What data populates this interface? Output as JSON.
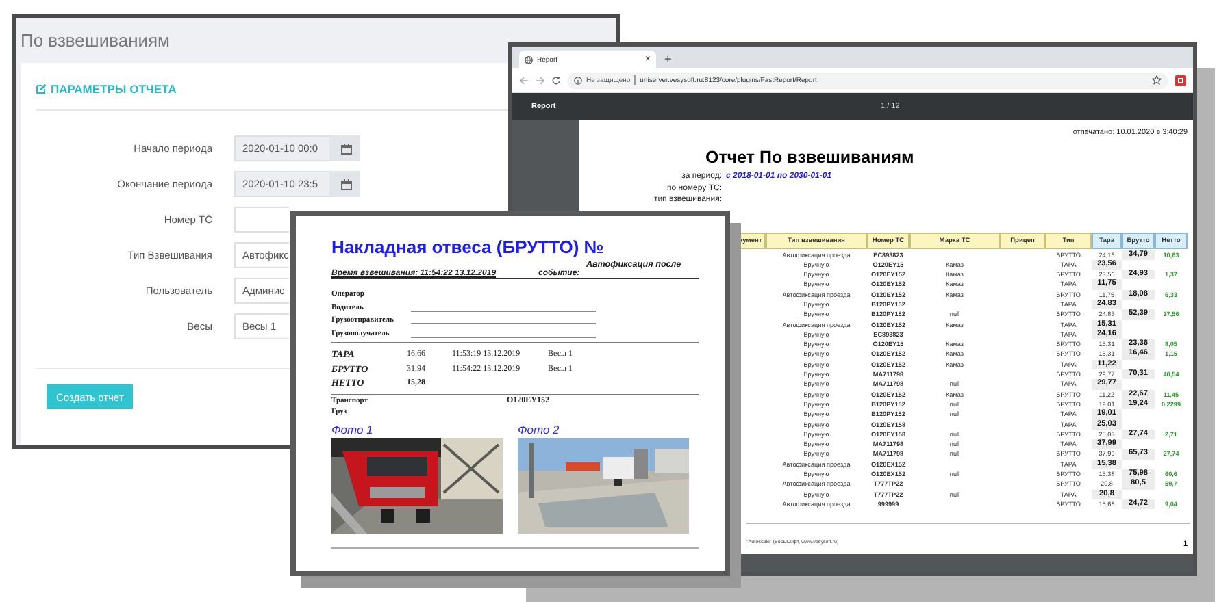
{
  "form_window": {
    "title": "По взвешиваниям",
    "section_title": "ПАРАМЕТРЫ ОТЧЕТА",
    "fields": [
      {
        "label": "Начало периода",
        "kind": "date",
        "value": "2020-01-10 00:0"
      },
      {
        "label": "Окончание периода",
        "kind": "date",
        "value": "2020-01-10 23:5"
      },
      {
        "label": "Номер ТС",
        "kind": "text"
      },
      {
        "label": "Тип Взвешивания",
        "kind": "select",
        "value": "Автофикс"
      },
      {
        "label": "Пользователь",
        "kind": "select",
        "value": "Админис"
      },
      {
        "label": "Весы",
        "kind": "select",
        "value": "Весы 1"
      }
    ],
    "submit_button": "Создать отчет"
  },
  "report_window": {
    "tab_title": "Report",
    "tab_close": "×",
    "new_tab": "+",
    "security_label": "Не защищено",
    "url": "uniserver.vesysoft.ru:8123/core/plugins/FastReport/Report",
    "viewer_title": "Report",
    "page_counter": "1 / 12",
    "report": {
      "title": "Отчет По взвешиваниям",
      "printed": "отпечатано: 10.01.2020 в 3:40:29",
      "meta": [
        {
          "label": "за период:",
          "value": "с 2018-01-01 по 2030-01-01"
        },
        {
          "label": "по номеру ТС:"
        },
        {
          "label": "тип взвешивания:"
        }
      ],
      "columns": [
        "кумент",
        "Тип взвешивания",
        "Номер ТС",
        "Марка ТС",
        "Прицеп",
        "Тип",
        "Тара",
        "Брутто",
        "Нетто"
      ],
      "rows": [
        {
          "weighing_type": "Автофиксация проезда",
          "plate": "EC893823",
          "type": "БРУТТО",
          "tara": "24,16",
          "brutto": "34,79",
          "netto": "10,63"
        },
        {
          "weighing_type": "Вручную",
          "plate": "O120EY15",
          "brand": "Камаз",
          "type": "ТАРА",
          "tara": "23,56"
        },
        {
          "weighing_type": "Вручную",
          "plate": "O120EY152",
          "brand": "Камаз",
          "type": "БРУТТО",
          "tara": "23,56",
          "brutto": "24,93",
          "netto": "1,37"
        },
        {
          "weighing_type": "Вручную",
          "plate": "O120EY152",
          "brand": "Камаз",
          "type": "ТАРА",
          "tara": "11,75"
        },
        {
          "weighing_type": "Автофиксация проезда",
          "plate": "O120EY152",
          "brand": "Камаз",
          "type": "БРУТТО",
          "tara": "11,75",
          "brutto": "18,08",
          "netto": "6,33"
        },
        {
          "weighing_type": "Вручную",
          "plate": "B120PY152",
          "type": "ТАРА",
          "tara": "24,83"
        },
        {
          "weighing_type": "Вручную",
          "plate": "B120PY152",
          "brand": "null",
          "type": "БРУТТО",
          "tara": "24,83",
          "brutto": "52,39",
          "netto": "27,56"
        },
        {
          "weighing_type": "Автофиксация проезда",
          "plate": "O120EY152",
          "brand": "Камаз",
          "type": "ТАРА",
          "tara": "15,31"
        },
        {
          "weighing_type": "Вручную",
          "plate": "EC893823",
          "type": "ТАРА",
          "tara": "24,16"
        },
        {
          "weighing_type": "Вручную",
          "plate": "O120EY15",
          "brand": "Камаз",
          "type": "БРУТТО",
          "tara": "15,31",
          "brutto": "23,36",
          "netto": "8,05"
        },
        {
          "weighing_type": "Вручную",
          "plate": "O120EY152",
          "brand": "Камаз",
          "type": "БРУТТО",
          "tara": "15,31",
          "brutto": "16,46",
          "netto": "1,15"
        },
        {
          "weighing_type": "Вручную",
          "plate": "O120EY152",
          "brand": "Камаз",
          "type": "ТАРА",
          "tara": "11,22"
        },
        {
          "weighing_type": "Вручную",
          "plate": "MA711798",
          "type": "БРУТТО",
          "tara": "29,77",
          "brutto": "70,31",
          "netto": "40,54"
        },
        {
          "weighing_type": "Вручную",
          "plate": "MA711798",
          "brand": "null",
          "type": "ТАРА",
          "tara": "29,77"
        },
        {
          "weighing_type": "Вручную",
          "plate": "O120EY152",
          "brand": "Камаз",
          "type": "БРУТТО",
          "tara": "11,22",
          "brutto": "22,67",
          "netto": "11,45"
        },
        {
          "weighing_type": "Вручную",
          "plate": "B120PY152",
          "brand": "null",
          "type": "БРУТТО",
          "tara": "19,01",
          "brutto": "19,24",
          "netto": "0,2299"
        },
        {
          "weighing_type": "Вручную",
          "plate": "B120PY152",
          "brand": "null",
          "type": "ТАРА",
          "tara": "19,01"
        },
        {
          "weighing_type": "Вручную",
          "plate": "O120EY158",
          "type": "ТАРА",
          "tara": "25,03"
        },
        {
          "weighing_type": "Вручную",
          "plate": "O120EY158",
          "brand": "null",
          "type": "БРУТТО",
          "tara": "25,03",
          "brutto": "27,74",
          "netto": "2,71"
        },
        {
          "weighing_type": "Вручную",
          "plate": "MA711798",
          "brand": "null",
          "type": "ТАРА",
          "tara": "37,99"
        },
        {
          "weighing_type": "Вручную",
          "plate": "MA711798",
          "brand": "null",
          "type": "БРУТТО",
          "tara": "37,99",
          "brutto": "65,73",
          "netto": "27,74"
        },
        {
          "weighing_type": "Автофиксация проезда",
          "plate": "O120EX152",
          "type": "ТАРА",
          "tara": "15,38"
        },
        {
          "weighing_type": "Вручную",
          "plate": "O120EX152",
          "brand": "null",
          "type": "БРУТТО",
          "tara": "15,38",
          "brutto": "75,98",
          "netto": "60,6"
        },
        {
          "weighing_type": "Автофиксация проезда",
          "plate": "T777TP22",
          "type": "БРУТТО",
          "tara": "20,8",
          "brutto": "80,5",
          "netto": "59,7"
        },
        {
          "weighing_type": "Вручную",
          "plate": "T777TP22",
          "brand": "null",
          "type": "ТАРА",
          "tara": "20,8"
        },
        {
          "weighing_type": "Автофиксация проезда",
          "plate": "999999",
          "type": "БРУТТО",
          "tara": "15,68",
          "brutto": "24,72",
          "netto": "9,04"
        }
      ],
      "footer": "\"Autoscale\" (ВесыСофт, www.vesysoft.ru)",
      "page_number": "1"
    }
  },
  "waybill_window": {
    "title": "Накладная отвеса (БРУТТО) №",
    "time": "Время взвешивания: 11:54:22 13.12.2019",
    "event_label": "событие:",
    "event_value": "Автофиксация после",
    "people": [
      {
        "label": "Оператор",
        "line": false
      },
      {
        "label": "Водитель",
        "line": true
      },
      {
        "label": "Грузоотправитель",
        "line": true
      },
      {
        "label": "Грузополучатель",
        "line": true
      }
    ],
    "weights": [
      {
        "label": "ТАРА",
        "value": "16,66",
        "time": "11:53:19 13.12.2019",
        "scale": "Весы 1"
      },
      {
        "label": "БРУТТО",
        "value": "31,94",
        "time": "11:54:22 13.12.2019",
        "scale": "Весы 1"
      },
      {
        "label": "НЕТТО",
        "value": "15,28"
      }
    ],
    "transport_label": "Транспорт",
    "transport_value": "O120EY152",
    "cargo_label": "Груз",
    "photos": [
      {
        "caption": "Фото 1",
        "kind": "picture"
      },
      {
        "caption": "Фото 2",
        "kind": "picture"
      }
    ]
  }
}
